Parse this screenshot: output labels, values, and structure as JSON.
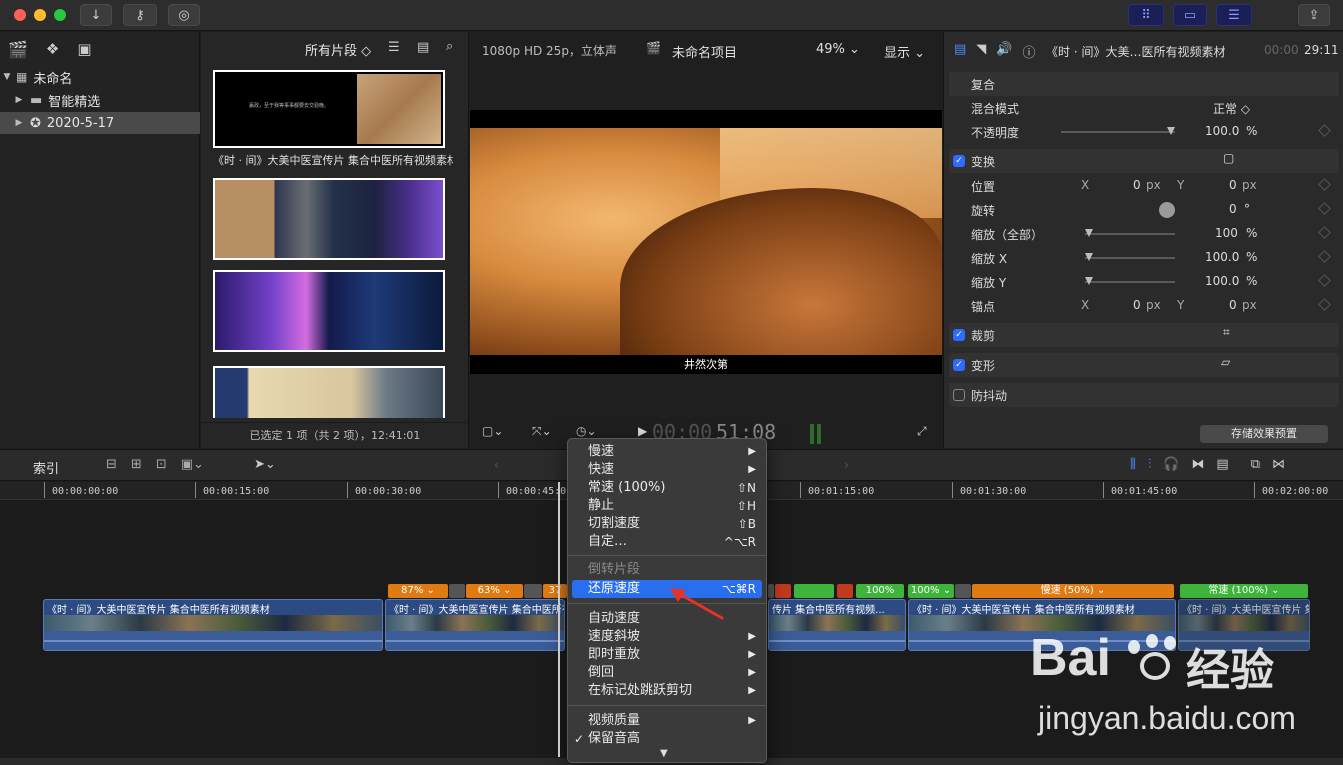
{
  "title_bar": {
    "buttons": [
      "import-icon",
      "key-icon",
      "check-icon"
    ],
    "right_buttons": [
      "grid-icon",
      "timeline-icon",
      "inspector-icon",
      "share-icon"
    ]
  },
  "library": {
    "items": [
      {
        "label": "未命名",
        "icon": "library-icon"
      },
      {
        "label": "智能精选",
        "icon": "folder-icon"
      },
      {
        "label": "2020-5-17",
        "icon": "event-icon"
      }
    ]
  },
  "browser": {
    "filter_label": "所有片段 ◇",
    "thumb_caption": "《时 · 间》大美中医宣传片 集合中医所有视频素材",
    "thumb_text": "嬴政，至于我等事事都要去交验晚。",
    "footer": "已选定 1 项（共 2 项），12:41:01"
  },
  "viewer": {
    "format": "1080p HD 25p，立体声",
    "project": "未命名项目",
    "zoom": "49% ⌄",
    "display": "显示 ⌄",
    "subtitle": "井然次第",
    "timecode_dim": "00:00",
    "timecode": "51:08"
  },
  "inspector": {
    "clip_name": "《时 · 间》大美…医所有视频素材",
    "duration_dim": "00:00",
    "duration": "29:11",
    "composite": "复合",
    "blend_mode_label": "混合模式",
    "blend_mode_value": "正常 ◇",
    "opacity_label": "不透明度",
    "opacity_value": "100.0",
    "transform": "变换",
    "position": "位置",
    "x": "X",
    "y": "Y",
    "zero": "0",
    "px": "px",
    "rotation": "旋转",
    "deg": "°",
    "scale_all": "缩放（全部）",
    "scale_all_value": "100",
    "scale_x": "缩放 X",
    "scale_x_value": "100.0",
    "scale_y": "缩放 Y",
    "scale_y_value": "100.0",
    "anchor": "锚点",
    "percent": "%",
    "crop": "裁剪",
    "distort": "变形",
    "stabilize": "防抖动",
    "save_preset": "存储效果预置"
  },
  "timeline": {
    "index_label": "索引",
    "ruler": [
      "00:00:00:00",
      "00:00:15:00",
      "00:00:30:00",
      "00:00:45:00",
      "00:01:15:00",
      "00:01:30:00",
      "00:01:45:00",
      "00:02:00:00"
    ],
    "clip_title": "《时 · 间》大美中医宣传片 集合中医所有视频素材",
    "clip_title_short": "《时 · 间》大美中医宣传片 集合中医所有视",
    "clip_title_mid": "传片 集合中医所有视频...",
    "speeds": {
      "s87": "87% ⌄",
      "s63": "63% ⌄",
      "s37": "37",
      "s100a": "100%",
      "s100b": "100% ⌄",
      "slow50": "慢速 (50%) ⌄",
      "normal100": "常速 (100%) ⌄"
    }
  },
  "context_menu": {
    "items": [
      {
        "label": "慢速",
        "submenu": "▶"
      },
      {
        "label": "快速",
        "submenu": "▶"
      },
      {
        "label": "常速 (100%)",
        "shortcut": "⇧N"
      },
      {
        "label": "静止",
        "shortcut": "⇧H"
      },
      {
        "label": "切割速度",
        "shortcut": "⇧B"
      },
      {
        "label": "自定…",
        "shortcut": "^⌥R"
      },
      {
        "label": "倒转片段"
      },
      {
        "label": "还原速度",
        "shortcut": "⌥⌘R"
      },
      {
        "label": "自动速度"
      },
      {
        "label": "速度斜坡",
        "submenu": "▶"
      },
      {
        "label": "即时重放",
        "submenu": "▶"
      },
      {
        "label": "倒回",
        "submenu": "▶"
      },
      {
        "label": "在标记处跳跃剪切",
        "submenu": "▶"
      },
      {
        "label": "视频质量",
        "submenu": "▶"
      },
      {
        "label": "保留音高",
        "check": "✓"
      }
    ]
  },
  "watermark": {
    "brand": "Bai",
    "brand2": "经验",
    "url": "jingyan.baidu.com"
  },
  "colors": {
    "accent": "#2a6ef0",
    "speed_orange": "#e07a12",
    "speed_green": "#3fb43a",
    "speed_red": "#c23a1e",
    "arrow": "#e63325"
  }
}
